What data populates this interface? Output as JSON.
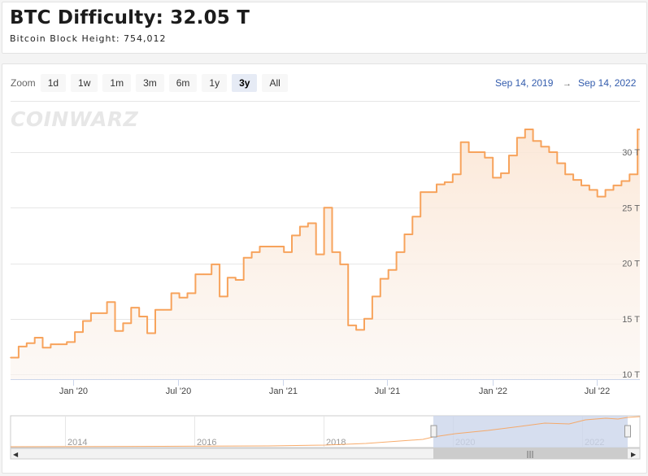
{
  "header": {
    "title": "BTC Difficulty: 32.05 T",
    "subtitle": "Bitcoin Block Height: 754,012"
  },
  "toolbar": {
    "zoom_label": "Zoom",
    "buttons": [
      "1d",
      "1w",
      "1m",
      "3m",
      "6m",
      "1y",
      "3y",
      "All"
    ],
    "active": "3y",
    "range_from": "Sep 14, 2019",
    "range_arrow": "→",
    "range_to": "Sep 14, 2022"
  },
  "watermark": "COINWARZ",
  "colors": {
    "line": "#f7a35c",
    "navigator_mask": "#ccd6eb",
    "range_text": "#335cad"
  },
  "chart_data": {
    "type": "area",
    "title": "BTC Difficulty",
    "y_unit": "T",
    "ylim": [
      10,
      32.05
    ],
    "yticks": [
      "10 T",
      "15 T",
      "20 T",
      "25 T",
      "30 T"
    ],
    "xticks": [
      "Jan '20",
      "Jul '20",
      "Jan '21",
      "Jul '21",
      "Jan '22",
      "Jul '22"
    ],
    "xlim": [
      "2019-09-14",
      "2022-09-14"
    ],
    "x": [
      "2019-09-14",
      "2019-09-28",
      "2019-10-12",
      "2019-10-26",
      "2019-11-09",
      "2019-11-23",
      "2019-12-07",
      "2019-12-21",
      "2020-01-04",
      "2020-01-18",
      "2020-02-01",
      "2020-02-15",
      "2020-02-29",
      "2020-03-14",
      "2020-03-28",
      "2020-04-11",
      "2020-04-25",
      "2020-05-09",
      "2020-05-23",
      "2020-06-06",
      "2020-06-20",
      "2020-07-04",
      "2020-07-18",
      "2020-08-01",
      "2020-08-15",
      "2020-08-29",
      "2020-09-12",
      "2020-09-26",
      "2020-10-10",
      "2020-10-24",
      "2020-11-07",
      "2020-11-21",
      "2020-12-05",
      "2020-12-19",
      "2021-01-02",
      "2021-01-16",
      "2021-01-30",
      "2021-02-13",
      "2021-02-27",
      "2021-03-13",
      "2021-03-27",
      "2021-04-10",
      "2021-04-24",
      "2021-05-08",
      "2021-05-22",
      "2021-06-05",
      "2021-06-19",
      "2021-07-03",
      "2021-07-17",
      "2021-07-31",
      "2021-08-14",
      "2021-08-28",
      "2021-09-11",
      "2021-09-25",
      "2021-10-09",
      "2021-10-23",
      "2021-11-06",
      "2021-11-20",
      "2021-12-04",
      "2021-12-18",
      "2022-01-01",
      "2022-01-15",
      "2022-01-29",
      "2022-02-12",
      "2022-02-26",
      "2022-03-12",
      "2022-03-26",
      "2022-04-09",
      "2022-04-23",
      "2022-05-07",
      "2022-05-21",
      "2022-06-04",
      "2022-06-18",
      "2022-07-02",
      "2022-07-16",
      "2022-07-30",
      "2022-08-13",
      "2022-08-27",
      "2022-09-10"
    ],
    "y": [
      11.5,
      12.5,
      12.8,
      13.3,
      12.4,
      12.7,
      12.7,
      12.9,
      13.8,
      14.8,
      15.5,
      15.5,
      16.5,
      13.9,
      14.6,
      16.0,
      15.2,
      13.7,
      15.8,
      15.8,
      17.3,
      16.9,
      17.3,
      19.0,
      19.0,
      19.9,
      17.0,
      18.7,
      18.5,
      20.5,
      21.0,
      21.5,
      21.5,
      21.5,
      21.0,
      22.5,
      23.3,
      23.6,
      20.8,
      25.0,
      21.0,
      19.9,
      14.4,
      14.0,
      15.0,
      17.0,
      18.6,
      19.4,
      21.0,
      22.6,
      24.2,
      26.4,
      26.4,
      27.1,
      27.3,
      28.0,
      30.9,
      30.0,
      30.0,
      29.5,
      27.7,
      28.1,
      29.7,
      31.3,
      32.05,
      31.0,
      30.5,
      30.0,
      29.0,
      28.0,
      27.5,
      27.0,
      26.6,
      26.0,
      26.6,
      27.0,
      27.4,
      28.0,
      32.05
    ]
  },
  "navigator": {
    "years": [
      "2014",
      "2016",
      "2018",
      "2020",
      "2022"
    ]
  }
}
